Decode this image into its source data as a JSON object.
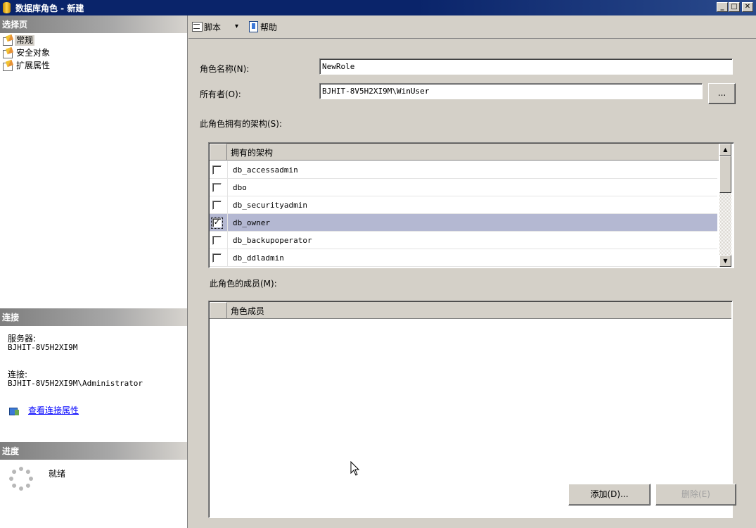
{
  "window": {
    "title": "数据库角色 - 新建",
    "buttons": {
      "minimize": "_",
      "maximize": "□",
      "close": "✕"
    }
  },
  "left_panel": {
    "pages_header": "选择页",
    "pages": [
      {
        "label": "常规",
        "icon": "page-wrench-icon",
        "selected": true
      },
      {
        "label": "安全对象",
        "icon": "page-wrench-icon",
        "selected": false
      },
      {
        "label": "扩展属性",
        "icon": "page-wrench-icon",
        "selected": false
      }
    ],
    "connection": {
      "header": "连接",
      "server_label": "服务器:",
      "server_value": "BJHIT-8V5H2XI9M",
      "connection_label": "连接:",
      "connection_value": "BJHIT-8V5H2XI9M\\Administrator",
      "properties_link": "查看连接属性"
    },
    "progress": {
      "header": "进度",
      "status": "就绪"
    }
  },
  "toolbar": {
    "script_label": "脚本",
    "dropdown_arrow": "▾",
    "help_label": "帮助"
  },
  "form": {
    "role_name_label": "角色名称(N):",
    "role_name_value": "NewRole",
    "owner_label": "所有者(O):",
    "owner_value": "BJHIT-8V5H2XI9M\\WinUser",
    "browse_button": "...",
    "owned_schemas_label": "此角色拥有的架构(S):",
    "schemas_grid": {
      "column_header": "拥有的架构",
      "rows": [
        {
          "name": "db_accessadmin",
          "checked": false,
          "mark": ""
        },
        {
          "name": "dbo",
          "checked": false,
          "mark": ""
        },
        {
          "name": "db_securityadmin",
          "checked": false,
          "mark": ""
        },
        {
          "name": "db_owner",
          "checked": true,
          "mark": "✓"
        },
        {
          "name": "db_backupoperator",
          "checked": false,
          "mark": ""
        },
        {
          "name": "db_ddladmin",
          "checked": false,
          "mark": ""
        }
      ],
      "scroll_up": "▲",
      "scroll_down": "▼"
    },
    "members_label": "此角色的成员(M):",
    "members_grid": {
      "column_header": "角色成员"
    },
    "add_button": "添加(D)...",
    "remove_button": "删除(E)"
  }
}
